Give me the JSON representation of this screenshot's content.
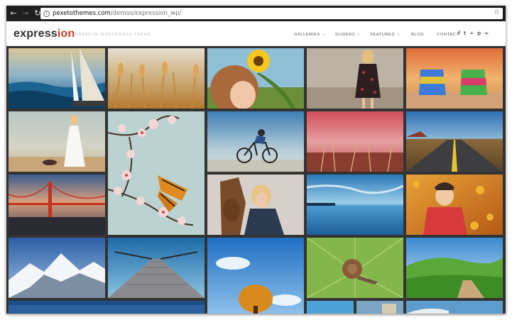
{
  "browser": {
    "url_host": "pexetothemes.com",
    "url_path": "/demos/expression_wp/",
    "back_icon": "arrow-left-icon",
    "forward_icon": "arrow-right-icon",
    "reload_icon": "reload-icon",
    "info_icon": "info-icon",
    "bookmark_icon": "star-icon"
  },
  "site": {
    "logo_main": "express",
    "logo_accent": "ion",
    "tagline": "PREMIUM WORDPRESS THEME",
    "accent_color": "#d23c2a"
  },
  "menu": {
    "items": [
      {
        "label": "GALLERIES",
        "has_dropdown": true
      },
      {
        "label": "SLIDERS",
        "has_dropdown": true
      },
      {
        "label": "FEATURES",
        "has_dropdown": true
      },
      {
        "label": "BLOG",
        "has_dropdown": false
      },
      {
        "label": "CONTACT",
        "has_dropdown": false
      }
    ]
  },
  "social": {
    "icons": [
      "facebook-icon",
      "twitter-icon",
      "googleplus-icon",
      "pinterest-icon",
      "rss-icon"
    ]
  },
  "gallery": {
    "images": [
      "sailboat-sea",
      "wheat-field",
      "child-sunflower",
      "woman-floral-dress",
      "beach-chairs-sunset",
      "bride-beach",
      "cherry-blossom-butterfly",
      "cyclist-road",
      "pink-grass-sky",
      "desert-highway",
      "golden-gate-bridge",
      "woman-horse",
      "blue-lake",
      "girl-autumn-leaves",
      "snowy-mountains",
      "wooden-pier",
      "autumn-tree-sky",
      "snail-leaf",
      "green-hills-path",
      "bottom-partial-1",
      "bottom-partial-2",
      "bottom-partial-3",
      "bottom-partial-4"
    ]
  }
}
